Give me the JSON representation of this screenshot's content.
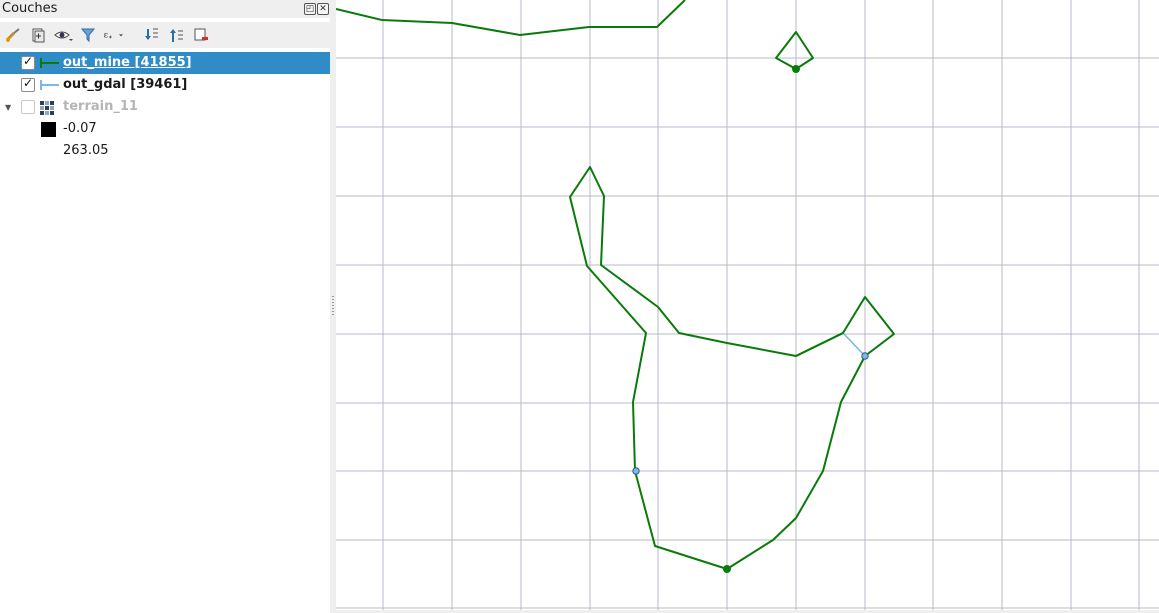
{
  "panel": {
    "title": "Couches",
    "toolbar_icons": [
      "paint-brush-icon",
      "add-group-icon",
      "eye-icon",
      "filter-icon",
      "expression-filter-icon",
      "expand-all-icon",
      "collapse-all-icon",
      "remove-layer-icon"
    ]
  },
  "layers": [
    {
      "name": "out_mine [41855]",
      "checked": true,
      "selected": true,
      "color": "#0a7a0a"
    },
    {
      "name": "out_gdal [39461]",
      "checked": true,
      "selected": false,
      "color": "#7ab8e8"
    },
    {
      "name": "terrain_11",
      "checked": false,
      "selected": false,
      "expanded": true,
      "legend": [
        {
          "value": "-0.07",
          "color": "#000000"
        },
        {
          "value": "263.05",
          "color": "#ffffff"
        }
      ]
    }
  ],
  "map": {
    "background": "#ffffff",
    "grid_color": "#b8b8c8",
    "line_color": "#0a7a0a",
    "highlight_color": "#7ab8e8"
  }
}
